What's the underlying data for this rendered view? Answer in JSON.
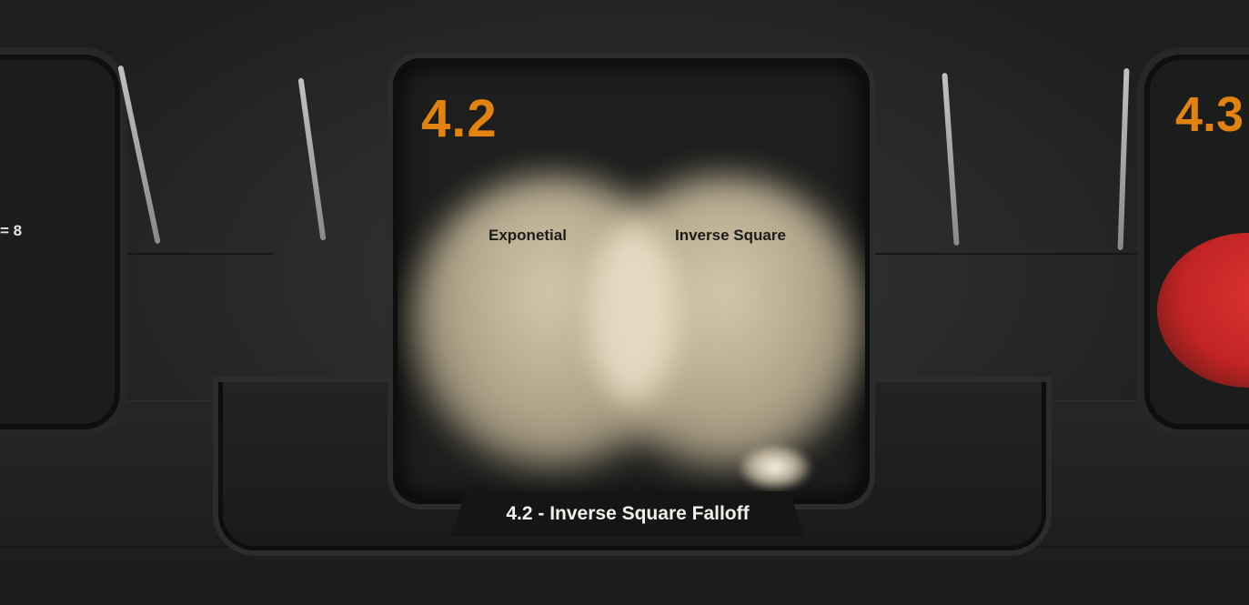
{
  "main_panel": {
    "number": "4.2",
    "labels": {
      "left": "Exponetial",
      "right": "Inverse Square"
    },
    "caption": "4.2 - Inverse Square Falloff"
  },
  "left_panel": {
    "partial_label": "= 8"
  },
  "right_panel": {
    "partial_number": "4.3"
  },
  "colors": {
    "accent_orange": "#e2830f",
    "light_glow": "#e0d2b4",
    "red_light": "#d33333",
    "panel_dark": "#1d1e1d"
  }
}
